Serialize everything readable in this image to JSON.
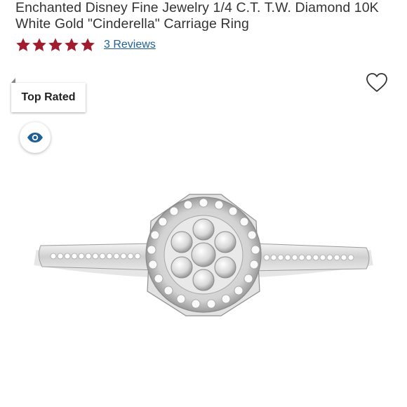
{
  "product": {
    "title": "Enchanted Disney Fine Jewelry 1/4 C.T. T.W. Diamond 10K White Gold \"Cinderella\" Carriage Ring",
    "rating": 5,
    "rating_max": 5,
    "reviews_label": "3 Reviews",
    "badge_label": "Top Rated"
  },
  "icons": {
    "wishlist": "heart-icon",
    "view": "eye-icon",
    "star": "star-icon"
  },
  "colors": {
    "star": "#a11d2e",
    "link": "#1f5f96",
    "eye": "#1f5f96"
  }
}
